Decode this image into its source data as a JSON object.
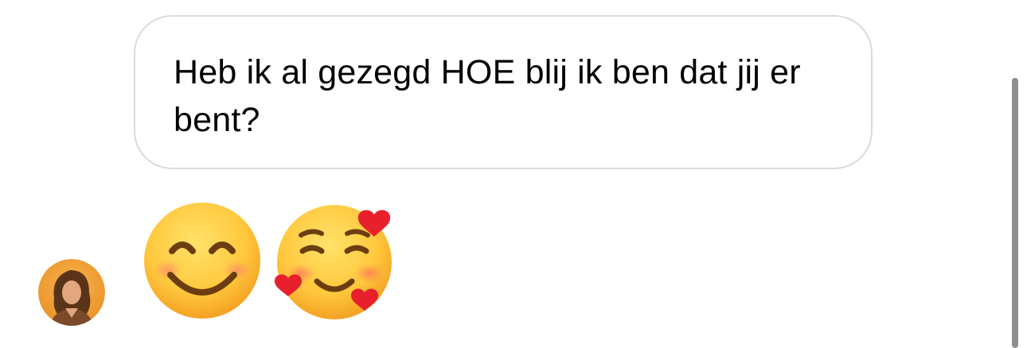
{
  "thread": {
    "message": {
      "text": "Heb ik al gezegd HOE blij ik ben dat jij er bent?"
    },
    "reaction_emojis": [
      {
        "name": "smiling-face-with-smiling-eyes-icon",
        "glyph": "😊"
      },
      {
        "name": "smiling-face-with-hearts-icon",
        "glyph": "🥰"
      }
    ],
    "sender": {
      "avatar_icon": "avatar-icon"
    }
  },
  "colors": {
    "bubble_border": "#dbdbdb",
    "text": "#000000",
    "scrollbar": "#8e8e8e",
    "avatar_bg": "#f2a23a",
    "heart": "#e8202c",
    "emoji_face": "#ffc83d"
  }
}
